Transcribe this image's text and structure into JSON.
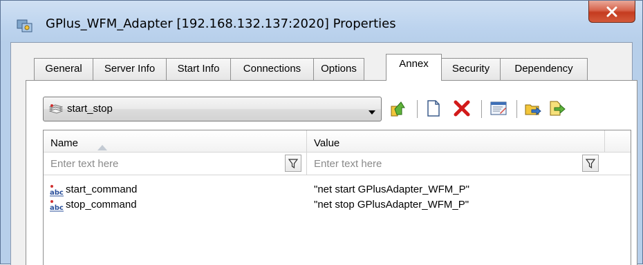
{
  "window": {
    "title": "GPlus_WFM_Adapter [192.168.132.137:2020] Properties",
    "close_label": "X",
    "app_icon": "application-icon"
  },
  "tabs": [
    {
      "label": "General"
    },
    {
      "label": "Server Info"
    },
    {
      "label": "Start Info"
    },
    {
      "label": "Connections"
    },
    {
      "label": "Options"
    },
    {
      "label": "Annex",
      "active": true
    },
    {
      "label": "Security"
    },
    {
      "label": "Dependency"
    }
  ],
  "annex": {
    "section_selected": "start_stop",
    "section_icon": "section-icon"
  },
  "toolbar": {
    "icons": [
      "move-up-icon",
      "new-item-icon",
      "delete-icon",
      "edit-icon",
      "import-icon",
      "export-icon"
    ]
  },
  "grid": {
    "columns": [
      {
        "label": "Name",
        "sorted": "ascending"
      },
      {
        "label": "Value"
      }
    ],
    "filter_placeholder": "Enter text here",
    "rows": [
      {
        "name": "start_command",
        "value": "\"net start GPlusAdapter_WFM_P\"",
        "icon": "string-type-icon"
      },
      {
        "name": "stop_command",
        "value": "\"net stop GPlusAdapter_WFM_P\"",
        "icon": "string-type-icon"
      }
    ]
  },
  "colors": {
    "frame": "#b7cfea",
    "close_button": "#c43b1f",
    "delete_red": "#d21a1a"
  }
}
